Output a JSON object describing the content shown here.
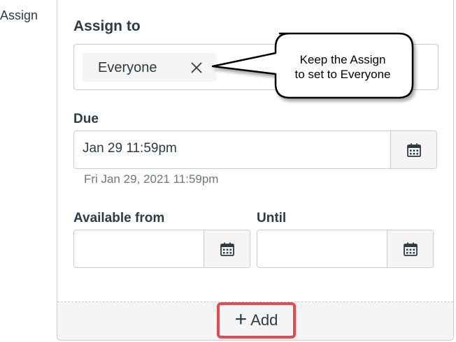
{
  "side_label": "Assign",
  "assign_section": {
    "title": "Assign to",
    "chips": [
      {
        "label": "Everyone"
      }
    ]
  },
  "due": {
    "label": "Due",
    "value": "Jan 29 11:59pm",
    "hint": "Fri Jan 29, 2021 11:59pm"
  },
  "available_from": {
    "label": "Available from",
    "value": ""
  },
  "until": {
    "label": "Until",
    "value": ""
  },
  "add_button": {
    "icon": "plus-icon",
    "label": "Add"
  },
  "callout": {
    "line1": "Keep the Assign",
    "line2": "to set to Everyone"
  },
  "colors": {
    "highlight": "#e94b4b",
    "text": "#2d3b45",
    "border": "#c7cdd1",
    "muted": "#6b7780"
  }
}
